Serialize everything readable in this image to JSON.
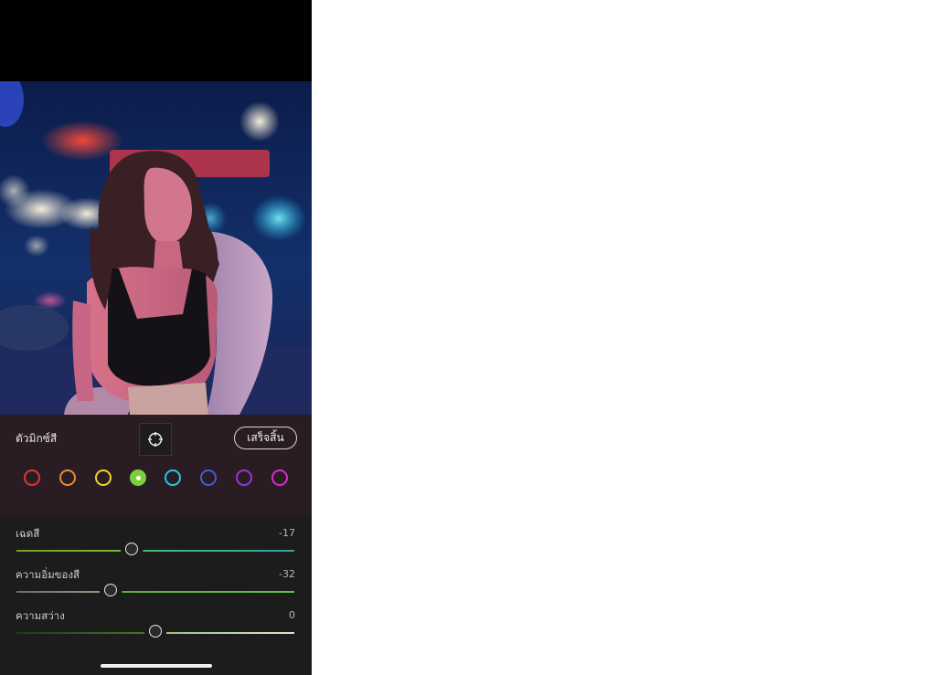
{
  "colors": {
    "panel_bg": "#2c1f26",
    "sliders_bg": "#1c1c1d",
    "accent_green": "#6ac03c"
  },
  "mixer": {
    "title": "ตัวมิกซ์สี",
    "target_icon": "crosshair-target-icon",
    "done_label": "เสร็จสิ้น",
    "swatches": [
      {
        "name": "red",
        "color": "#e0333d",
        "selected": false
      },
      {
        "name": "orange",
        "color": "#eb8a2c",
        "selected": false
      },
      {
        "name": "yellow",
        "color": "#f2d22b",
        "selected": false
      },
      {
        "name": "green",
        "color": "#7ccf3a",
        "selected": true
      },
      {
        "name": "aqua",
        "color": "#23c9e0",
        "selected": false
      },
      {
        "name": "blue",
        "color": "#4759d6",
        "selected": false
      },
      {
        "name": "purple",
        "color": "#9a35dc",
        "selected": false
      },
      {
        "name": "magenta",
        "color": "#d92ad8",
        "selected": false
      }
    ]
  },
  "sliders": [
    {
      "label": "เฉดสี",
      "value": "-17",
      "amount": -17,
      "min": -100,
      "max": 100,
      "type": "hue"
    },
    {
      "label": "ความอิ่มของสี",
      "value": "-32",
      "amount": -32,
      "min": -100,
      "max": 100,
      "type": "saturation"
    },
    {
      "label": "ความสว่าง",
      "value": "0",
      "amount": 0,
      "min": -100,
      "max": 100,
      "type": "luminance"
    }
  ]
}
